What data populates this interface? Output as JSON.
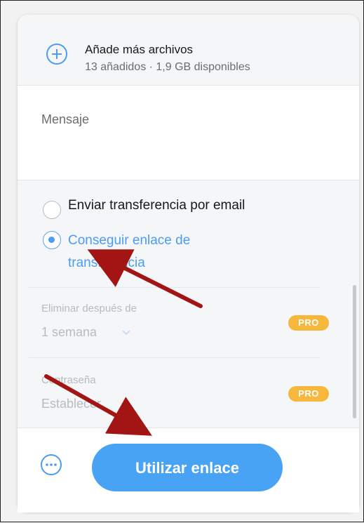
{
  "files": {
    "icon": "plus-circle-icon",
    "title": "Añade más archivos",
    "subtitle": "13 añadidos · 1,9 GB disponibles"
  },
  "message": {
    "label": "Mensaje"
  },
  "transfer_options": [
    {
      "label": "Enviar transferencia por email",
      "selected": false
    },
    {
      "label": "Conseguir enlace de transferencia",
      "selected": true
    }
  ],
  "settings": {
    "delete_after": {
      "label": "Eliminar después de",
      "value": "1 semana",
      "badge": "PRO"
    },
    "password": {
      "label": "Contraseña",
      "value": "Establecer",
      "badge": "PRO"
    }
  },
  "footer": {
    "more_icon": "more-options-icon",
    "button_label": "Utilizar enlace"
  },
  "colors": {
    "accent": "#4a9cf4",
    "badge": "#f6b73c",
    "annotation_arrow": "#a31515"
  }
}
